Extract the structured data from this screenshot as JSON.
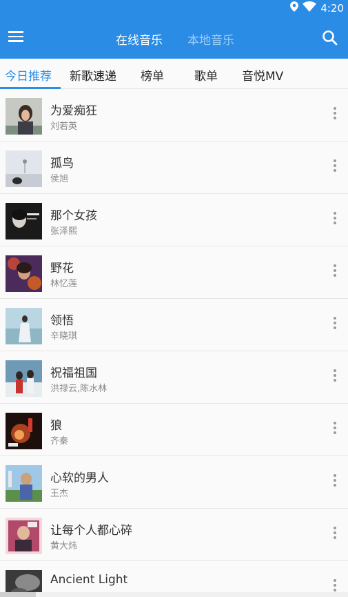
{
  "status_bar": {
    "time": "4:20",
    "icons": [
      "location-icon",
      "wifi-icon",
      "battery-icon"
    ]
  },
  "app_bar": {
    "menu_icon": "hamburger-menu-icon",
    "tabs": [
      {
        "label": "在线音乐",
        "active": true
      },
      {
        "label": "本地音乐",
        "active": false
      }
    ],
    "search_icon": "search-icon",
    "color": "#2b8ce6"
  },
  "sub_tabs": [
    {
      "label": "今日推荐",
      "active": true
    },
    {
      "label": "新歌速递",
      "active": false
    },
    {
      "label": "榜单",
      "active": false
    },
    {
      "label": "歌单",
      "active": false
    },
    {
      "label": "音悦MV",
      "active": false
    }
  ],
  "songs": [
    {
      "title": "为爱痴狂",
      "artist": "刘若英"
    },
    {
      "title": "孤鸟",
      "artist": "侯旭"
    },
    {
      "title": "那个女孩",
      "artist": "张泽熙"
    },
    {
      "title": "野花",
      "artist": "林忆莲"
    },
    {
      "title": "领悟",
      "artist": "辛晓琪"
    },
    {
      "title": "祝福祖国",
      "artist": "洪禄云,陈水林"
    },
    {
      "title": "狼",
      "artist": "齐秦"
    },
    {
      "title": "心软的男人",
      "artist": "王杰"
    },
    {
      "title": "让每个人都心碎",
      "artist": "黄大炜"
    },
    {
      "title": "Ancient Light",
      "artist": ""
    }
  ],
  "more_icon": "more-vertical-icon",
  "accent_color": "#2b8ce6"
}
